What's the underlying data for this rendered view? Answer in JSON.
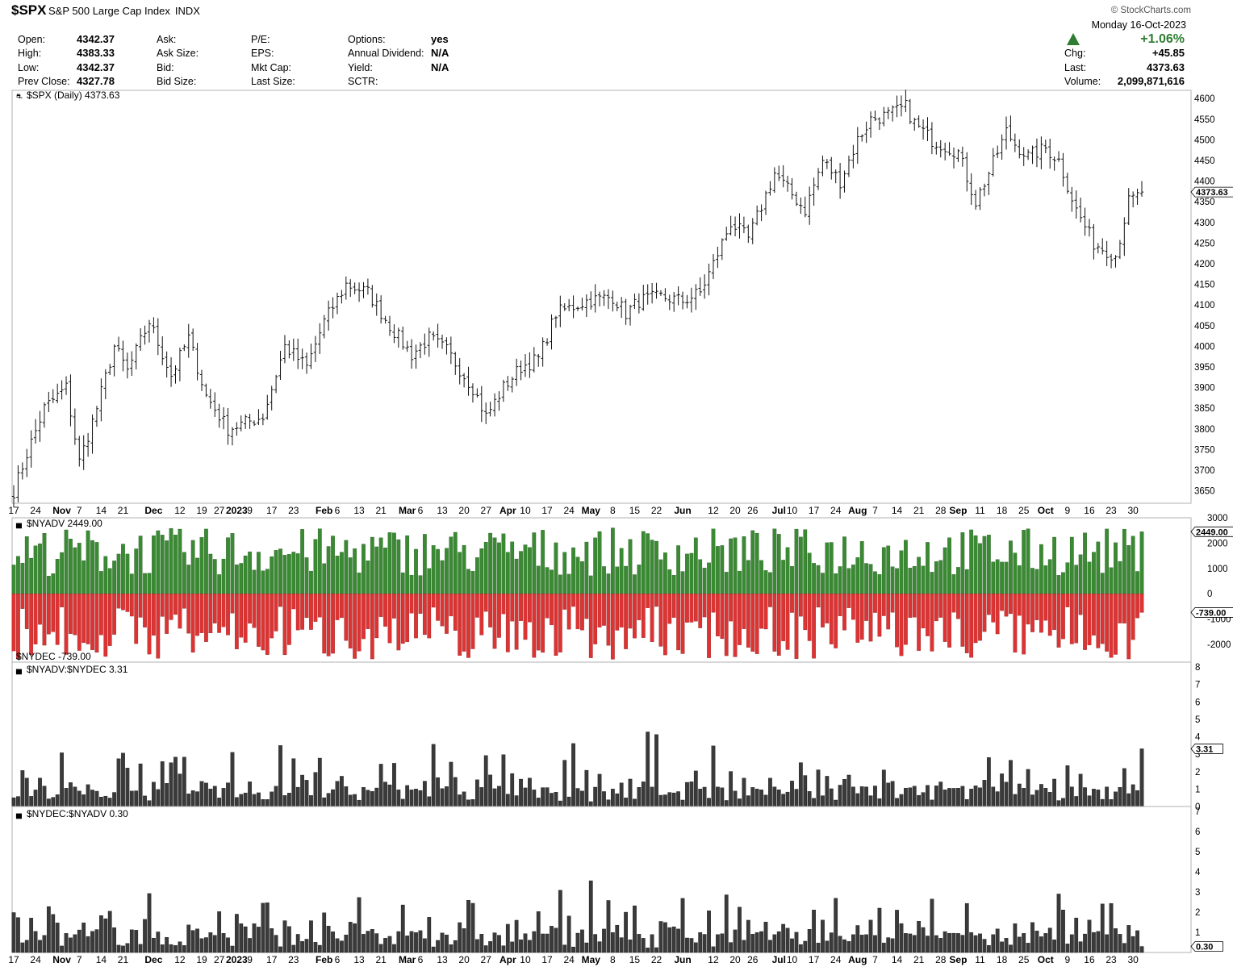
{
  "header": {
    "symbol": "$SPX",
    "name": "S&P 500 Large Cap Index",
    "exchange": "INDX",
    "copyright": "© StockCharts.com",
    "date": "Monday  16-Oct-2023",
    "pct_change": "+1.06%",
    "up_color": "#2e7d32",
    "fields": {
      "open_label": "Open:",
      "open": "4342.37",
      "high_label": "High:",
      "high": "4383.33",
      "low_label": "Low:",
      "low": "4342.37",
      "prev_label": "Prev Close:",
      "prev": "4327.78",
      "ask_label": "Ask:",
      "asksize_label": "Ask Size:",
      "bid_label": "Bid:",
      "bidsize_label": "Bid Size:",
      "pe_label": "P/E:",
      "eps_label": "EPS:",
      "mktcap_label": "Mkt Cap:",
      "lastsize_label": "Last Size:",
      "options_label": "Options:",
      "options": "yes",
      "div_label": "Annual Dividend:",
      "div": "N/A",
      "yield_label": "Yield:",
      "yield": "N/A",
      "sctr_label": "SCTR:",
      "chg_label": "Chg:",
      "chg": "+45.85",
      "last_label": "Last:",
      "last": "4373.63",
      "volume_label": "Volume:",
      "volume": "2,099,871,616"
    }
  },
  "chart_data": [
    {
      "type": "ohlc",
      "title": "$SPX (Daily) 4373.63",
      "last_value": "4373.63",
      "ylim": [
        3620,
        4620
      ],
      "yticks": [
        3650,
        3700,
        3750,
        3800,
        3850,
        3900,
        3950,
        4000,
        4050,
        4100,
        4150,
        4200,
        4250,
        4300,
        4350,
        4400,
        4450,
        4500,
        4550,
        4600
      ],
      "anchors": [
        [
          0,
          3650
        ],
        [
          3,
          3740
        ],
        [
          7,
          3850
        ],
        [
          12,
          3900
        ],
        [
          15,
          3720
        ],
        [
          19,
          3850
        ],
        [
          23,
          4000
        ],
        [
          26,
          3940
        ],
        [
          31,
          4060
        ],
        [
          36,
          3930
        ],
        [
          40,
          4020
        ],
        [
          44,
          3880
        ],
        [
          49,
          3800
        ],
        [
          57,
          3830
        ],
        [
          62,
          4000
        ],
        [
          67,
          3950
        ],
        [
          71,
          4060
        ],
        [
          76,
          4150
        ],
        [
          81,
          4130
        ],
        [
          86,
          4050
        ],
        [
          91,
          3980
        ],
        [
          95,
          4020
        ],
        [
          99,
          3990
        ],
        [
          105,
          3900
        ],
        [
          108,
          3830
        ],
        [
          112,
          3900
        ],
        [
          116,
          3950
        ],
        [
          120,
          3970
        ],
        [
          124,
          4080
        ],
        [
          131,
          4110
        ],
        [
          137,
          4120
        ],
        [
          140,
          4080
        ],
        [
          143,
          4110
        ],
        [
          148,
          4120
        ],
        [
          153,
          4110
        ],
        [
          157,
          4130
        ],
        [
          160,
          4200
        ],
        [
          164,
          4300
        ],
        [
          168,
          4260
        ],
        [
          174,
          4420
        ],
        [
          177,
          4380
        ],
        [
          181,
          4330
        ],
        [
          185,
          4450
        ],
        [
          189,
          4400
        ],
        [
          193,
          4500
        ],
        [
          196,
          4550
        ],
        [
          200,
          4560
        ],
        [
          204,
          4580
        ],
        [
          206,
          4540
        ],
        [
          210,
          4500
        ],
        [
          216,
          4470
        ],
        [
          220,
          4350
        ],
        [
          223,
          4420
        ],
        [
          227,
          4520
        ],
        [
          229,
          4490
        ],
        [
          232,
          4460
        ],
        [
          236,
          4480
        ],
        [
          239,
          4450
        ],
        [
          241,
          4390
        ],
        [
          243,
          4330
        ],
        [
          247,
          4250
        ],
        [
          252,
          4220
        ],
        [
          255,
          4350
        ],
        [
          258,
          4370
        ]
      ]
    },
    {
      "type": "bar",
      "title": "$NYADV 2449.00",
      "bottom_title": "$NYDEC -739.00",
      "last_adv": "2449.00",
      "last_dec": "-739.00",
      "ylim": [
        -2700,
        3000
      ],
      "yticks": [
        "3000",
        "2000",
        "1000",
        "0",
        "-1000",
        "-2000"
      ],
      "adv_color": "#3a8a33",
      "dec_color": "#dd3333",
      "series": [
        {
          "name": "$NYADV",
          "base": 1500,
          "last": 2449
        },
        {
          "name": "$NYDEC",
          "base": -1400,
          "last": -739
        }
      ]
    },
    {
      "type": "bar",
      "title": "$NYADV:$NYDEC 3.31",
      "last_value": "3.31",
      "ylim": [
        0,
        8
      ],
      "yticks": [
        "8",
        "7",
        "6",
        "5",
        "4",
        "3",
        "2",
        "1",
        "0"
      ],
      "color": "#3a3a3a"
    },
    {
      "type": "bar",
      "title": "$NYDEC:$NYADV 0.30",
      "last_value": "0.30",
      "ylim": [
        0,
        7
      ],
      "yticks": [
        "7",
        "6",
        "5",
        "4",
        "3",
        "2",
        "1"
      ],
      "color": "#3a3a3a"
    }
  ],
  "x_axis": {
    "labels": [
      {
        "t": "17",
        "i": 0,
        "b": false
      },
      {
        "t": "24",
        "i": 5,
        "b": false
      },
      {
        "t": "Nov",
        "i": 11,
        "b": true
      },
      {
        "t": "7",
        "i": 15,
        "b": false
      },
      {
        "t": "14",
        "i": 20,
        "b": false
      },
      {
        "t": "21",
        "i": 25,
        "b": false
      },
      {
        "t": "Dec",
        "i": 32,
        "b": true
      },
      {
        "t": "12",
        "i": 38,
        "b": false
      },
      {
        "t": "19",
        "i": 43,
        "b": false
      },
      {
        "t": "27",
        "i": 47,
        "b": false
      },
      {
        "t": "2023",
        "i": 51,
        "b": true
      },
      {
        "t": "9",
        "i": 54,
        "b": false
      },
      {
        "t": "17",
        "i": 59,
        "b": false
      },
      {
        "t": "23",
        "i": 64,
        "b": false
      },
      {
        "t": "Feb",
        "i": 71,
        "b": true
      },
      {
        "t": "6",
        "i": 74,
        "b": false
      },
      {
        "t": "13",
        "i": 79,
        "b": false
      },
      {
        "t": "21",
        "i": 84,
        "b": false
      },
      {
        "t": "Mar",
        "i": 90,
        "b": true
      },
      {
        "t": "6",
        "i": 93,
        "b": false
      },
      {
        "t": "13",
        "i": 98,
        "b": false
      },
      {
        "t": "20",
        "i": 103,
        "b": false
      },
      {
        "t": "27",
        "i": 108,
        "b": false
      },
      {
        "t": "Apr",
        "i": 113,
        "b": true
      },
      {
        "t": "10",
        "i": 117,
        "b": false
      },
      {
        "t": "17",
        "i": 122,
        "b": false
      },
      {
        "t": "24",
        "i": 127,
        "b": false
      },
      {
        "t": "May",
        "i": 132,
        "b": true
      },
      {
        "t": "8",
        "i": 137,
        "b": false
      },
      {
        "t": "15",
        "i": 142,
        "b": false
      },
      {
        "t": "22",
        "i": 147,
        "b": false
      },
      {
        "t": "Jun",
        "i": 153,
        "b": true
      },
      {
        "t": "12",
        "i": 160,
        "b": false
      },
      {
        "t": "20",
        "i": 165,
        "b": false
      },
      {
        "t": "26",
        "i": 169,
        "b": false
      },
      {
        "t": "Jul",
        "i": 175,
        "b": true
      },
      {
        "t": "10",
        "i": 178,
        "b": false
      },
      {
        "t": "17",
        "i": 183,
        "b": false
      },
      {
        "t": "24",
        "i": 188,
        "b": false
      },
      {
        "t": "Aug",
        "i": 193,
        "b": true
      },
      {
        "t": "7",
        "i": 197,
        "b": false
      },
      {
        "t": "14",
        "i": 202,
        "b": false
      },
      {
        "t": "21",
        "i": 207,
        "b": false
      },
      {
        "t": "28",
        "i": 212,
        "b": false
      },
      {
        "t": "Sep",
        "i": 216,
        "b": true
      },
      {
        "t": "11",
        "i": 221,
        "b": false
      },
      {
        "t": "18",
        "i": 226,
        "b": false
      },
      {
        "t": "25",
        "i": 231,
        "b": false
      },
      {
        "t": "Oct",
        "i": 236,
        "b": true
      },
      {
        "t": "9",
        "i": 241,
        "b": false
      },
      {
        "t": "16",
        "i": 246,
        "b": false
      },
      {
        "t": "23",
        "i": 251,
        "b": false
      },
      {
        "t": "30",
        "i": 256,
        "b": false
      }
    ],
    "count": 259
  }
}
